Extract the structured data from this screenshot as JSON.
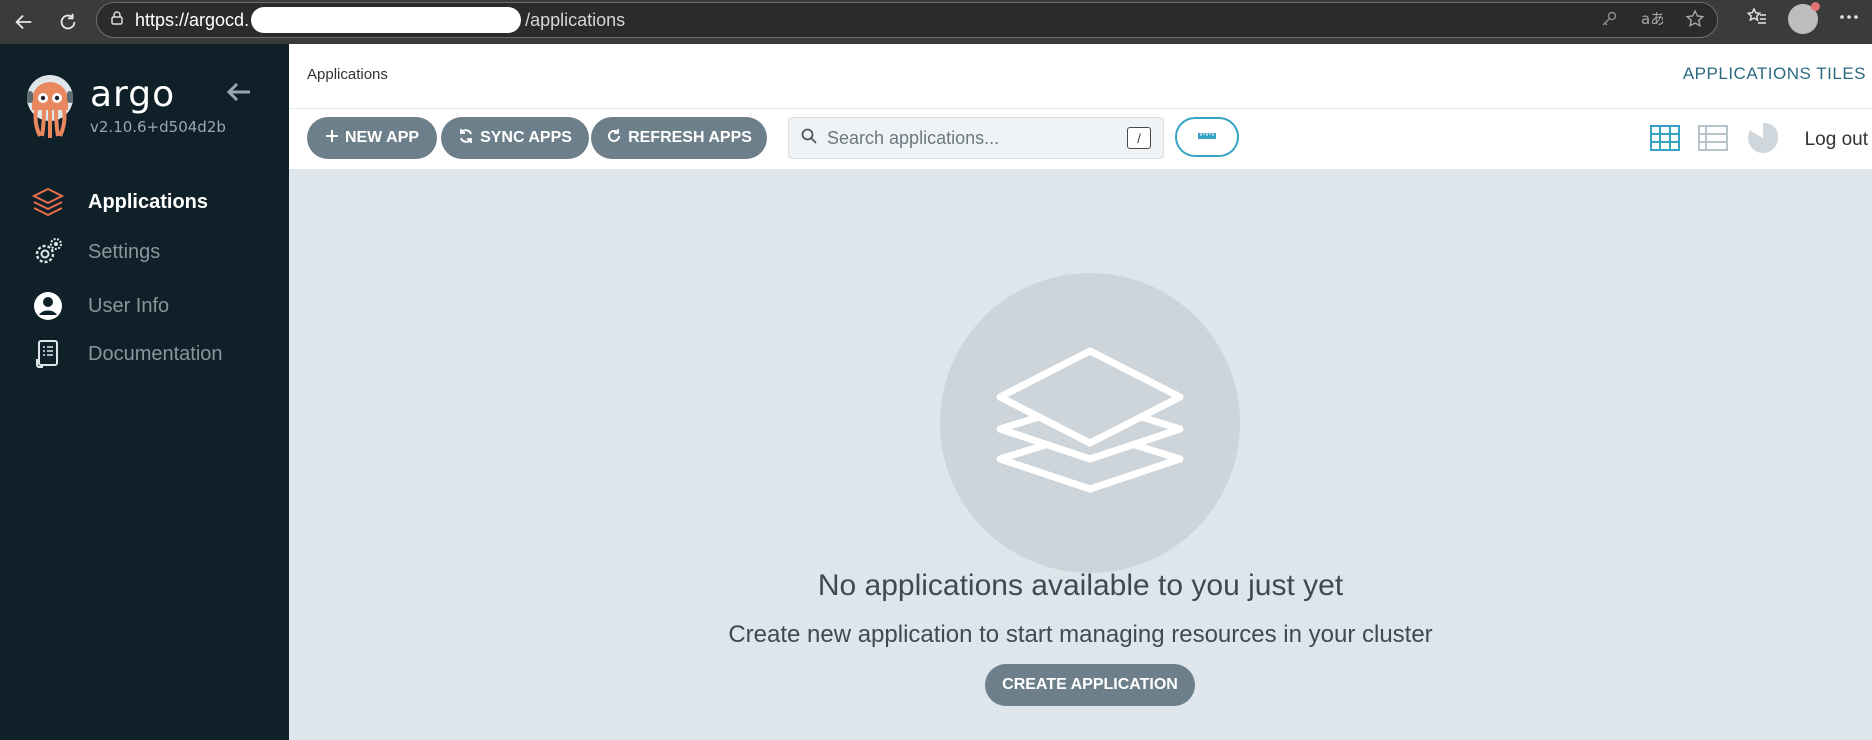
{
  "browser": {
    "url_prefix": "https://argocd.",
    "url_suffix": "/applications"
  },
  "sidebar": {
    "brand": "argo",
    "version": "v2.10.6+d504d2b",
    "items": [
      {
        "label": "Applications",
        "icon": "layers-icon",
        "active": true
      },
      {
        "label": "Settings",
        "icon": "gears-icon",
        "active": false
      },
      {
        "label": "User Info",
        "icon": "user-circle-icon",
        "active": false
      },
      {
        "label": "Documentation",
        "icon": "book-icon",
        "active": false
      }
    ]
  },
  "header": {
    "page_title": "Applications",
    "view_title": "APPLICATIONS TILES"
  },
  "toolbar": {
    "new_app": "NEW APP",
    "sync_apps": "SYNC APPS",
    "refresh_apps": "REFRESH APPS",
    "search_placeholder": "Search applications...",
    "search_shortcut": "/",
    "logout": "Log out"
  },
  "empty_state": {
    "title": "No applications available to you just yet",
    "subtitle": "Create new application to start managing resources in your cluster",
    "button": "CREATE APPLICATION"
  },
  "colors": {
    "sidebar_bg": "#0f2029",
    "accent": "#36a3c4",
    "button_bg": "#6d7f8b",
    "active_icon": "#e96d4c"
  }
}
